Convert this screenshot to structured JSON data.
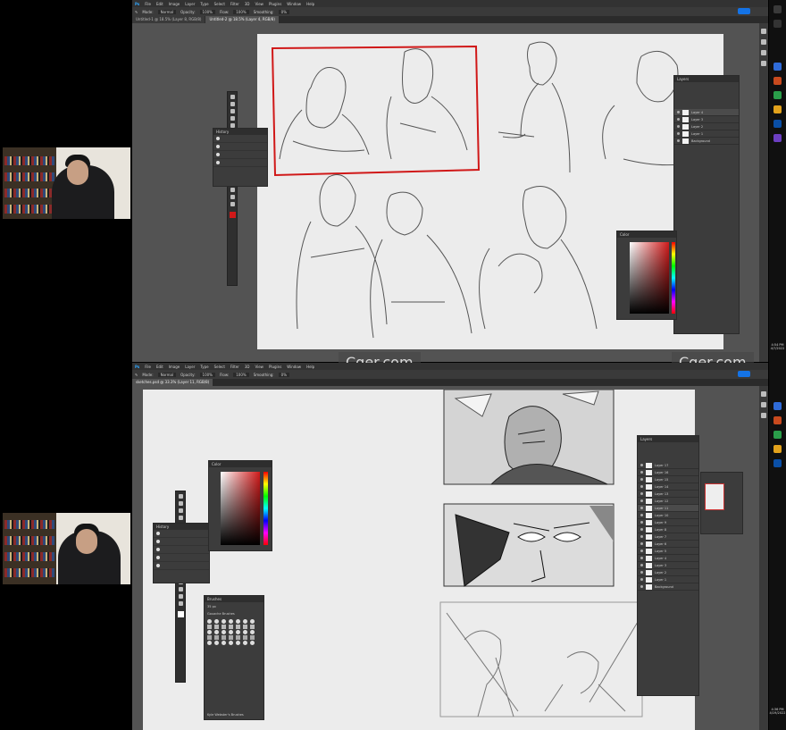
{
  "watermark": {
    "text": "Cger.com"
  },
  "window_top": {
    "menu": [
      "Ps",
      "File",
      "Edit",
      "Image",
      "Layer",
      "Type",
      "Select",
      "Filter",
      "3D",
      "View",
      "Plugins",
      "Window",
      "Help"
    ],
    "options": {
      "mode_label": "Mode:",
      "mode_value": "Normal",
      "opacity_label": "Opacity:",
      "opacity_value": "100%",
      "flow_label": "Flow:",
      "flow_value": "100%",
      "smoothing_label": "Smoothing:",
      "smoothing_value": "0%"
    },
    "tabs": [
      "Untitled-1 @ 18.5% (Layer 8, RGB/8)",
      "Untitled-2 @ 18.5% (Layer 4, RGB/8)"
    ],
    "layers_panel_title": "Layers",
    "layers": [
      "Layer 4",
      "Layer 3",
      "Layer 2",
      "Layer 1",
      "Background"
    ],
    "color_panel_title": "Color",
    "history_panel_title": "History"
  },
  "window_bottom": {
    "menu": [
      "Ps",
      "File",
      "Edit",
      "Image",
      "Layer",
      "Type",
      "Select",
      "Filter",
      "3D",
      "View",
      "Plugins",
      "Window",
      "Help"
    ],
    "options": {
      "mode_label": "Mode:",
      "mode_value": "Normal",
      "opacity_label": "Opacity:",
      "opacity_value": "100%",
      "flow_label": "Flow:",
      "flow_value": "100%",
      "smoothing_label": "Smoothing:",
      "smoothing_value": "0%"
    },
    "tabs": [
      "sketches.psd @ 33.3% (Layer 11, RGB/8)"
    ],
    "layers_panel_title": "Layers",
    "layers": [
      "Layer 17",
      "Layer 16",
      "Layer 15",
      "Layer 14",
      "Layer 13",
      "Layer 12",
      "Layer 11",
      "Layer 10",
      "Layer 9",
      "Layer 8",
      "Layer 7",
      "Layer 6",
      "Layer 5",
      "Layer 4",
      "Layer 3",
      "Layer 2",
      "Layer 1",
      "Background"
    ],
    "color_panel_title": "Color",
    "history_panel_title": "History",
    "brushes_panel_title": "Brushes",
    "brush_size": "35 px",
    "brush_group": "Gouache Brushes",
    "brush_footer": "Kyle Webster's Brushes"
  },
  "taskbar": {
    "time_top": "4:54 PM",
    "date_top": "4/7/2022",
    "time_bottom": "4:36 PM",
    "date_bottom": "4/19/2022"
  }
}
